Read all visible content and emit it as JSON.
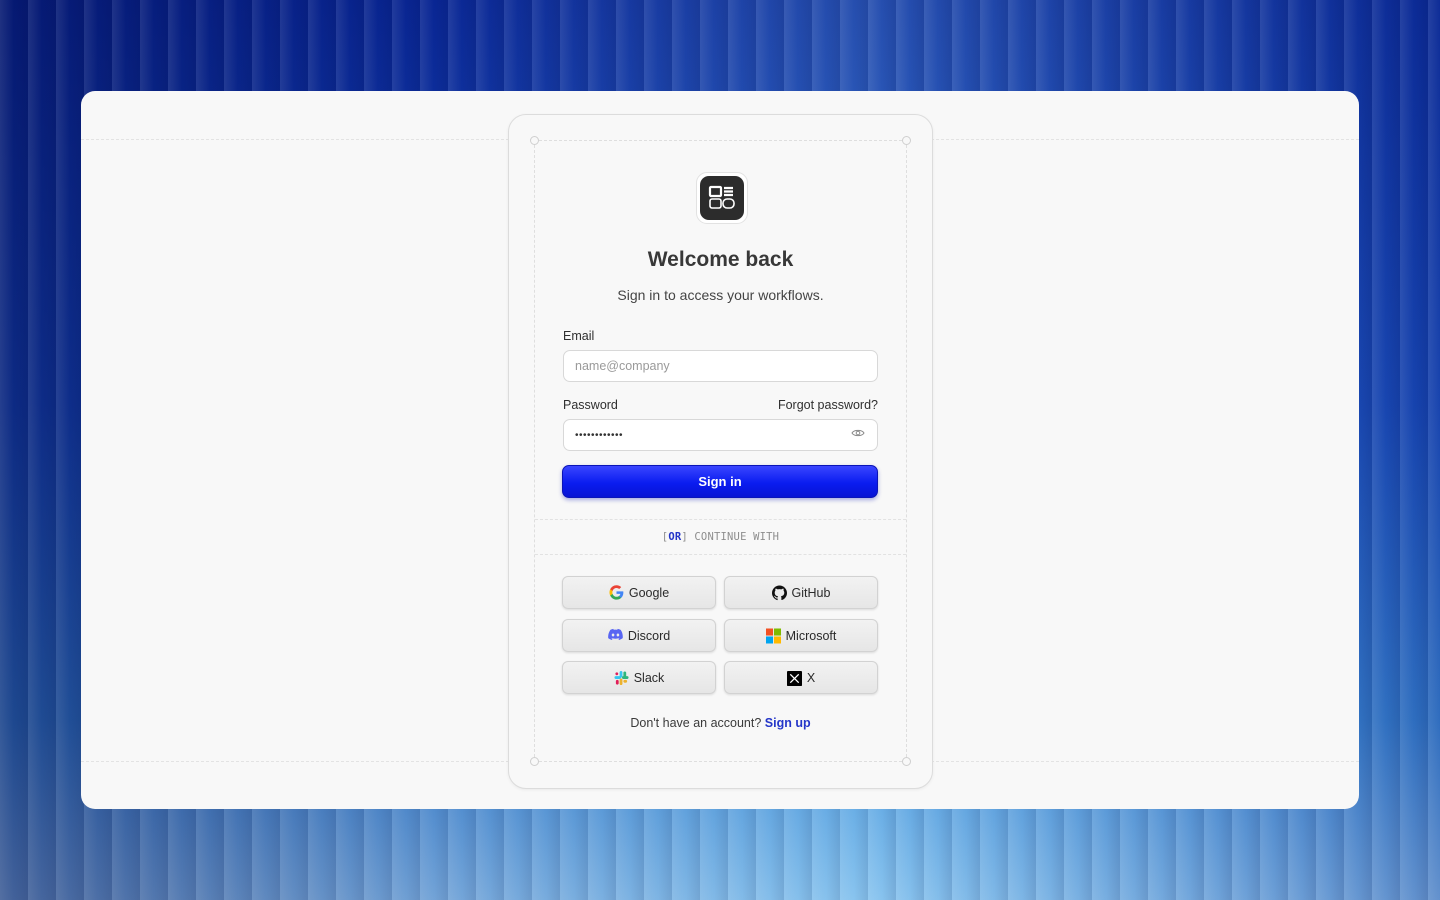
{
  "logo": {
    "alt": "app-logo"
  },
  "heading": {
    "title": "Welcome back",
    "subtitle": "Sign in to access your workflows."
  },
  "form": {
    "email_label": "Email",
    "email_placeholder": "name@company",
    "email_value": "",
    "password_label": "Password",
    "forgot_label": "Forgot password?",
    "password_value": "••••••••••••",
    "signin_label": "Sign in"
  },
  "divider": {
    "bracket_open": "[",
    "or": "OR",
    "bracket_close": "]",
    "text": " CONTINUE WITH"
  },
  "social": {
    "google": "Google",
    "github": "GitHub",
    "discord": "Discord",
    "microsoft": "Microsoft",
    "slack": "Slack",
    "x": "X"
  },
  "footer": {
    "prompt": "Don't have an account?",
    "signup": "Sign up"
  },
  "colors": {
    "primary": "#0a1cf0",
    "link": "#2436c9"
  }
}
